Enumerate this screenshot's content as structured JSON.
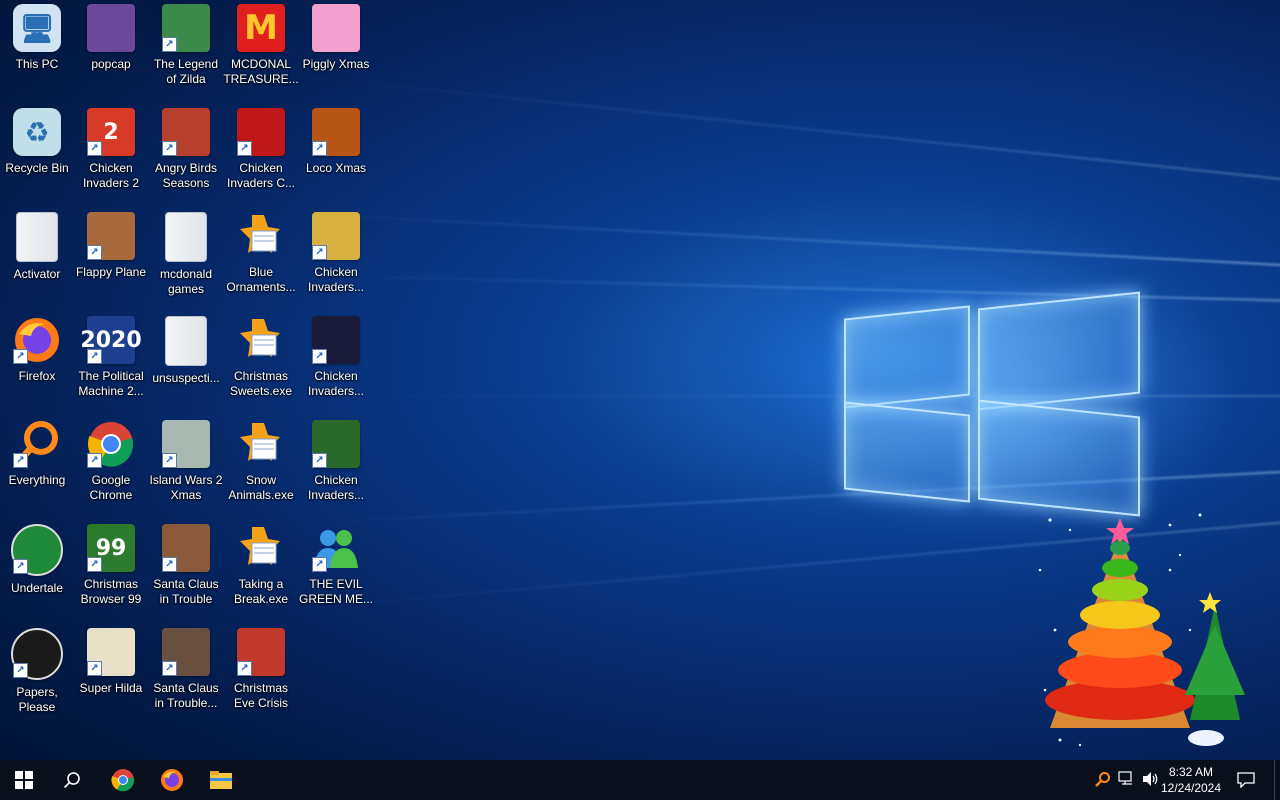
{
  "desktop": {
    "icons": [
      {
        "label": "This PC",
        "icon": "this-pc-icon",
        "glyph": "🖥",
        "bg": "#cfe3f5",
        "shortcut": false
      },
      {
        "label": "Recycle Bin",
        "icon": "recycle-bin-icon",
        "glyph": "♻",
        "bg": "#bfe0e8",
        "shortcut": false
      },
      {
        "label": "Activator",
        "icon": "folder-icon",
        "glyph": "",
        "bg": "#eef1f4",
        "shortcut": false
      },
      {
        "label": "Firefox",
        "icon": "firefox-icon",
        "glyph": "",
        "bg": "#ff7a17",
        "shortcut": true
      },
      {
        "label": "Everything",
        "icon": "everything-icon",
        "glyph": "",
        "bg": "transparent",
        "shortcut": true
      },
      {
        "label": "Undertale",
        "icon": "undertale-icon",
        "glyph": "",
        "bg": "#1e8a3a",
        "shortcut": true
      },
      {
        "label": "Papers,\nPlease",
        "icon": "papers-please-icon",
        "glyph": "",
        "bg": "#1a1a1a",
        "shortcut": true
      },
      {
        "label": "popcap",
        "icon": "popcap-icon",
        "glyph": "",
        "bg": "#6b4a9b",
        "shortcut": false
      },
      {
        "label": "Chicken\nInvaders 2",
        "icon": "chicken-invaders-2-icon",
        "glyph": "2",
        "bg": "#d83a2a",
        "shortcut": true
      },
      {
        "label": "Flappy Plane",
        "icon": "flappy-plane-icon",
        "glyph": "",
        "bg": "#a86a3c",
        "shortcut": true
      },
      {
        "label": "The Political\nMachine 2...",
        "icon": "political-machine-icon",
        "glyph": "2020",
        "bg": "#1d3f8f",
        "shortcut": true
      },
      {
        "label": "Google\nChrome",
        "icon": "chrome-icon",
        "glyph": "",
        "bg": "transparent",
        "shortcut": true
      },
      {
        "label": "Christmas\nBrowser 99",
        "icon": "christmas-browser-icon",
        "glyph": "99",
        "bg": "#2c7a2c",
        "shortcut": true
      },
      {
        "label": "Super Hilda",
        "icon": "super-hilda-icon",
        "glyph": "",
        "bg": "#e8e0c8",
        "shortcut": true
      },
      {
        "label": "The Legend\nof Zilda",
        "icon": "legend-of-zilda-icon",
        "glyph": "",
        "bg": "#3c8a4a",
        "shortcut": true
      },
      {
        "label": "Angry Birds\nSeasons",
        "icon": "angry-birds-seasons-icon",
        "glyph": "",
        "bg": "#b8402c",
        "shortcut": true
      },
      {
        "label": "mcdonald\ngames",
        "icon": "folder-icon",
        "glyph": "",
        "bg": "#eef1f4",
        "shortcut": false
      },
      {
        "label": "unsuspecti...",
        "icon": "folder-icon",
        "glyph": "",
        "bg": "#eef1f4",
        "shortcut": false
      },
      {
        "label": "Island Wars 2\nXmas",
        "icon": "island-wars-icon",
        "glyph": "",
        "bg": "#a8b8b0",
        "shortcut": true
      },
      {
        "label": "Santa Claus\nin Trouble",
        "icon": "santa-claus-trouble-icon",
        "glyph": "",
        "bg": "#8a5a3a",
        "shortcut": true
      },
      {
        "label": "Santa Claus\nin Trouble...",
        "icon": "santa-claus-trouble-2-icon",
        "glyph": "",
        "bg": "#6a5040",
        "shortcut": true
      },
      {
        "label": "MCDONAL\nTREASURE...",
        "icon": "mcdonalds-icon",
        "glyph": "M",
        "bg": "#e21f1f",
        "shortcut": false
      },
      {
        "label": "Chicken\nInvaders C...",
        "icon": "chicken-invaders-c-icon",
        "glyph": "",
        "bg": "#c01818",
        "shortcut": true
      },
      {
        "label": "Blue\nOrnaments...",
        "icon": "exe-icon",
        "glyph": "",
        "bg": "transparent",
        "shortcut": false
      },
      {
        "label": "Christmas\nSweets.exe",
        "icon": "exe-icon",
        "glyph": "",
        "bg": "transparent",
        "shortcut": false
      },
      {
        "label": "Snow\nAnimals.exe",
        "icon": "exe-icon",
        "glyph": "",
        "bg": "transparent",
        "shortcut": false
      },
      {
        "label": "Taking a\nBreak.exe",
        "icon": "exe-icon",
        "glyph": "",
        "bg": "transparent",
        "shortcut": false
      },
      {
        "label": "Christmas\nEve Crisis",
        "icon": "christmas-eve-crisis-icon",
        "glyph": "",
        "bg": "#c0392b",
        "shortcut": true
      },
      {
        "label": "Piggly Xmas",
        "icon": "piggly-xmas-icon",
        "glyph": "",
        "bg": "#f2a0d0",
        "shortcut": false
      },
      {
        "label": "Loco Xmas",
        "icon": "loco-xmas-icon",
        "glyph": "",
        "bg": "#b8561a",
        "shortcut": true
      },
      {
        "label": "Chicken\nInvaders...",
        "icon": "chicken-invaders-3-icon",
        "glyph": "",
        "bg": "#d8b040",
        "shortcut": true
      },
      {
        "label": "Chicken\nInvaders...",
        "icon": "chicken-invaders-4-icon",
        "glyph": "",
        "bg": "#1a1a3a",
        "shortcut": true
      },
      {
        "label": "Chicken\nInvaders...",
        "icon": "chicken-invaders-5-icon",
        "glyph": "",
        "bg": "#2a6a2a",
        "shortcut": true
      },
      {
        "label": "THE EVIL\nGREEN ME...",
        "icon": "messenger-icon",
        "glyph": "",
        "bg": "transparent",
        "shortcut": true
      }
    ]
  },
  "taskbar": {
    "clock_time": "8:32 AM",
    "clock_date": "12/24/2024",
    "colors": {
      "bg": "#0a0f1c",
      "accent": "#1e88ff"
    }
  }
}
